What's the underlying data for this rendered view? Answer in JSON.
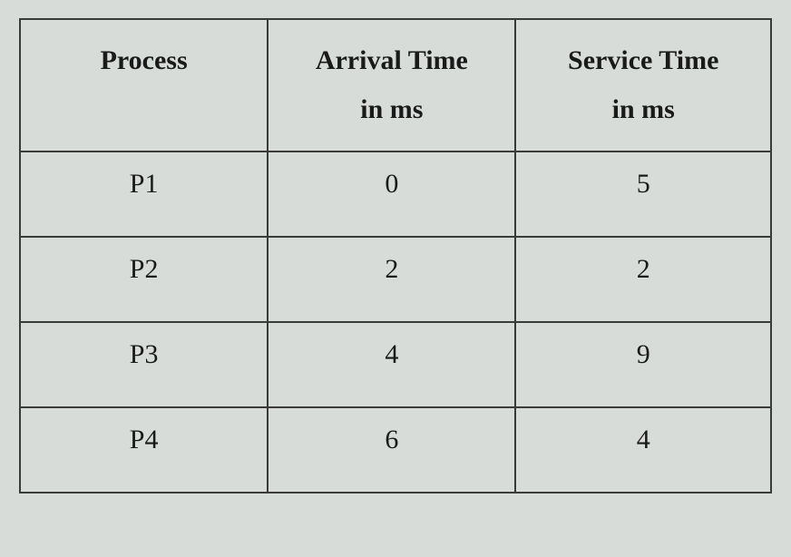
{
  "chart_data": {
    "type": "table",
    "headers": {
      "process": "Process",
      "arrival": "Arrival Time in ms",
      "service": "Service Time in ms"
    },
    "rows": [
      {
        "process": "P1",
        "arrival": "0",
        "service": "5"
      },
      {
        "process": "P2",
        "arrival": "2",
        "service": "2"
      },
      {
        "process": "P3",
        "arrival": "4",
        "service": "9"
      },
      {
        "process": "P4",
        "arrival": "6",
        "service": "4"
      }
    ]
  },
  "headers_lines": {
    "process_l1": "Process",
    "arrival_l1": "Arrival Time",
    "arrival_l2": "in ms",
    "service_l1": "Service Time",
    "service_l2": "in ms"
  }
}
